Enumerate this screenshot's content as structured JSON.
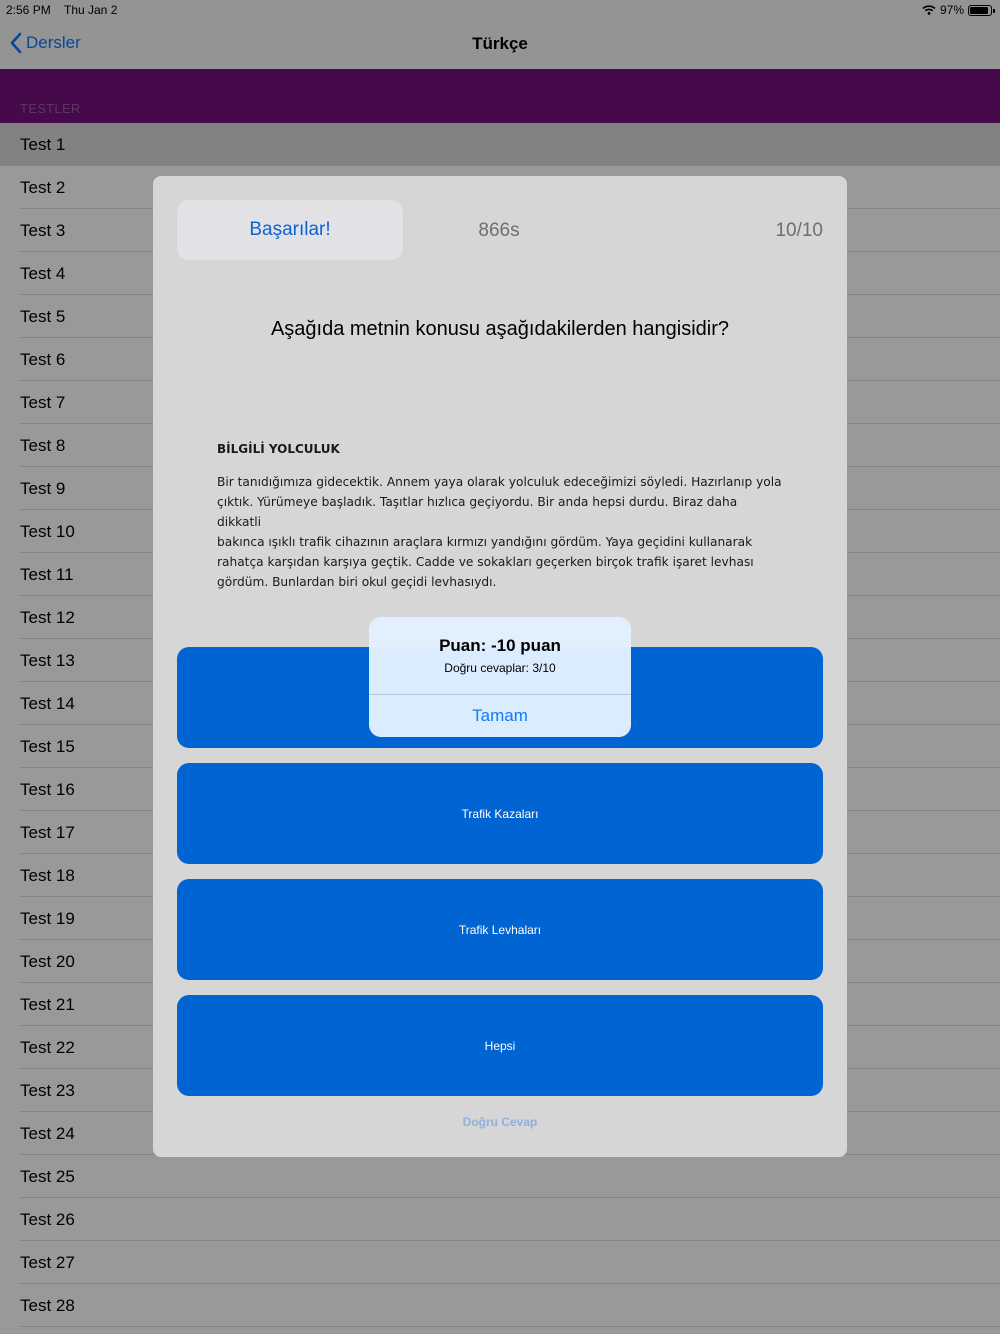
{
  "status_bar": {
    "time": "2:56 PM",
    "date": "Thu Jan 2",
    "battery": "97%"
  },
  "nav": {
    "back_label": "Dersler",
    "title": "Türkçe"
  },
  "section": {
    "header": "TESTLER",
    "accent_color": "#74107f"
  },
  "tests": [
    "Test 1",
    "Test 2",
    "Test 3",
    "Test 4",
    "Test 5",
    "Test 6",
    "Test 7",
    "Test 8",
    "Test 9",
    "Test 10",
    "Test 11",
    "Test 12",
    "Test 13",
    "Test 14",
    "Test 15",
    "Test 16",
    "Test 17",
    "Test 18",
    "Test 19",
    "Test 20",
    "Test 21",
    "Test 22",
    "Test 23",
    "Test 24",
    "Test 25",
    "Test 26",
    "Test 27",
    "Test 28"
  ],
  "selected_test": "Test 1",
  "quiz": {
    "congrats_label": "Başarılar!",
    "timer": "866s",
    "progress": "10/10",
    "question": "Aşağıda metnin konusu aşağıdakilerden hangisidir?",
    "passage_title": "BİLGİLİ YOLCULUK",
    "passage_lines": [
      "Bir tanıdığımıza gidecektik. Annem yaya olarak yolculuk edeceğimizi söyledi. Hazırlanıp yola",
      "çıktık. Yürümeye başladık. Taşıtlar hızlıca geçiyordu. Bir anda hepsi durdu. Biraz daha dikkatli",
      "bakınca ışıklı trafik cihazının araçlara kırmızı yandığını gördüm. Yaya geçidini kullanarak",
      "rahatça karşıdan karşıya geçtik. Cadde ve sokakları geçerken birçok trafik işaret levhası",
      "gördüm. Bunlardan biri okul geçidi levhasıydı."
    ],
    "answers": [
      "",
      "Trafik Kazaları",
      "Trafik Levhaları",
      "Hepsi"
    ],
    "correct_answer_label": "Doğru Cevap",
    "answer_color": "#0064d2"
  },
  "alert": {
    "title": "Puan: -10 puan",
    "message": "Doğru cevaplar: 3/10",
    "button": "Tamam"
  }
}
